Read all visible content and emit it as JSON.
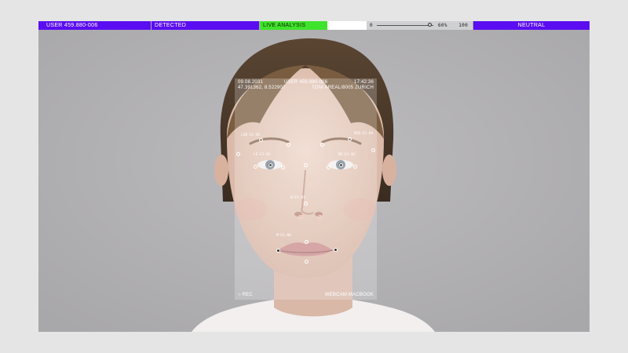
{
  "topbar": {
    "user": "USER 459.880-006",
    "detected": "DETECTED",
    "live": "LIVE ANALYSIS",
    "slider_min": "0",
    "slider_value": "60%",
    "slider_max": "100",
    "slider_level": 0.6,
    "emotion": "NEUTRAL"
  },
  "overlay": {
    "date": "09.08.2031",
    "user": "USER 459.880-006",
    "time": "17:42:36",
    "coords": "47.391362, 8.522907",
    "location": "TONI AREAL/8005 ZURICH",
    "rec": "○ REC",
    "camera": "WEBCAM MACBOOK"
  },
  "landmarks": {
    "left_brow": "LEB-E1-05",
    "right_brow": "REB-E1-04",
    "left_eye": "LE-E1-02",
    "right_eye": "RE-E1-02",
    "nose": "N-E1-05",
    "mouth": "M-E1-06"
  },
  "colors": {
    "accent": "#5b0df1",
    "live": "#3fe32b",
    "background": "#b6b4b7"
  }
}
